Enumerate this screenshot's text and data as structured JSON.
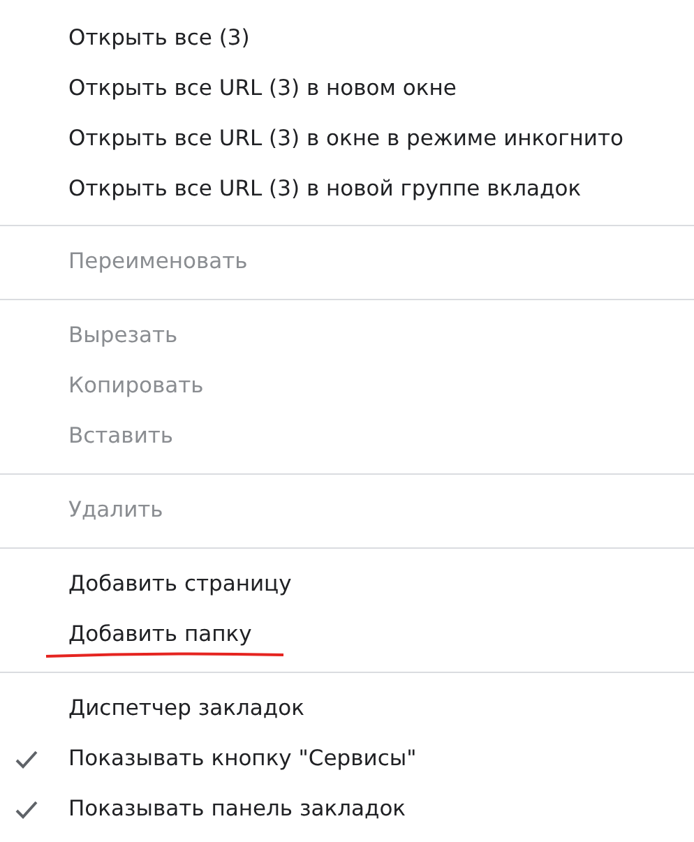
{
  "menu": {
    "groups": [
      {
        "items": [
          {
            "label": "Открыть все (3)",
            "disabled": false,
            "checked": false,
            "underlined": false
          },
          {
            "label": "Открыть все URL (3) в новом окне",
            "disabled": false,
            "checked": false,
            "underlined": false
          },
          {
            "label": "Открыть все URL (3) в окне в режиме инкогнито",
            "disabled": false,
            "checked": false,
            "underlined": false
          },
          {
            "label": "Открыть все URL (3) в новой группе вкладок",
            "disabled": false,
            "checked": false,
            "underlined": false
          }
        ]
      },
      {
        "items": [
          {
            "label": "Переименовать",
            "disabled": true,
            "checked": false,
            "underlined": false
          }
        ]
      },
      {
        "items": [
          {
            "label": "Вырезать",
            "disabled": true,
            "checked": false,
            "underlined": false
          },
          {
            "label": "Копировать",
            "disabled": true,
            "checked": false,
            "underlined": false
          },
          {
            "label": "Вставить",
            "disabled": true,
            "checked": false,
            "underlined": false
          }
        ]
      },
      {
        "items": [
          {
            "label": "Удалить",
            "disabled": true,
            "checked": false,
            "underlined": false
          }
        ]
      },
      {
        "items": [
          {
            "label": "Добавить страницу",
            "disabled": false,
            "checked": false,
            "underlined": false
          },
          {
            "label": "Добавить папку",
            "disabled": false,
            "checked": false,
            "underlined": true
          }
        ]
      },
      {
        "items": [
          {
            "label": "Диспетчер закладок",
            "disabled": false,
            "checked": false,
            "underlined": false
          },
          {
            "label": "Показывать кнопку \"Сервисы\"",
            "disabled": false,
            "checked": true,
            "underlined": false
          },
          {
            "label": "Показывать панель закладок",
            "disabled": false,
            "checked": true,
            "underlined": false
          }
        ]
      }
    ]
  }
}
